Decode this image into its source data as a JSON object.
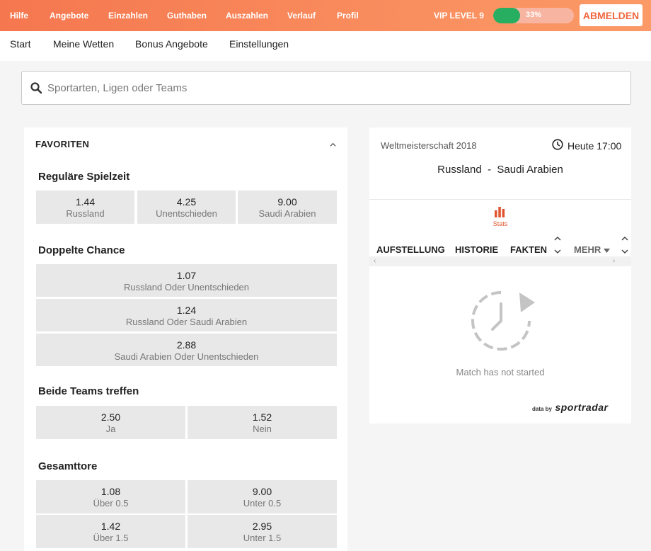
{
  "topnav": {
    "items": [
      "Hilfe",
      "Angebote",
      "Einzahlen",
      "Guthaben",
      "Auszahlen",
      "Verlauf",
      "Profil"
    ],
    "vip": "VIP LEVEL 9",
    "progress_text": "33%",
    "progress": 0.33,
    "logout": "ABMELDEN"
  },
  "subnav": {
    "items": [
      "Start",
      "Meine Wetten",
      "Bonus Angebote",
      "Einstellungen"
    ]
  },
  "search": {
    "placeholder": "Sportarten, Ligen oder Teams"
  },
  "favorites": {
    "title": "FAVORITEN",
    "sections": [
      {
        "title": "Reguläre Spielzeit",
        "rows": [
          [
            {
              "odd": "1.44",
              "label": "Russland"
            },
            {
              "odd": "4.25",
              "label": "Unentschieden"
            },
            {
              "odd": "9.00",
              "label": "Saudi Arabien"
            }
          ]
        ]
      },
      {
        "title": "Doppelte Chance",
        "rows": [
          [
            {
              "odd": "1.07",
              "label": "Russland Oder Unentschieden"
            }
          ],
          [
            {
              "odd": "1.24",
              "label": "Russland Oder Saudi Arabien"
            }
          ],
          [
            {
              "odd": "2.88",
              "label": "Saudi Arabien Oder Unentschieden"
            }
          ]
        ]
      },
      {
        "title": "Beide Teams treffen",
        "rows": [
          [
            {
              "odd": "2.50",
              "label": "Ja"
            },
            {
              "odd": "1.52",
              "label": "Nein"
            }
          ]
        ]
      },
      {
        "title": "Gesamttore",
        "rows": [
          [
            {
              "odd": "1.08",
              "label": "Über 0.5"
            },
            {
              "odd": "9.00",
              "label": "Unter 0.5"
            }
          ],
          [
            {
              "odd": "1.42",
              "label": "Über 1.5"
            },
            {
              "odd": "2.95",
              "label": "Unter 1.5"
            }
          ]
        ]
      }
    ]
  },
  "match": {
    "competition": "Weltmeisterschaft 2018",
    "time": "Heute 17:00",
    "home": "Russland",
    "separator": "-",
    "away": "Saudi Arabien",
    "stats_label": "Stats",
    "tabs": [
      "AUFSTELLUNG",
      "HISTORIE",
      "FAKTEN",
      "MEHR"
    ],
    "status": "Match has not started",
    "provider_prefix": "data by",
    "provider": "sportradar"
  },
  "colors": {
    "accent": "#f0663f",
    "progress_fill": "#27ae60",
    "cell_bg": "#e8e8e8"
  }
}
